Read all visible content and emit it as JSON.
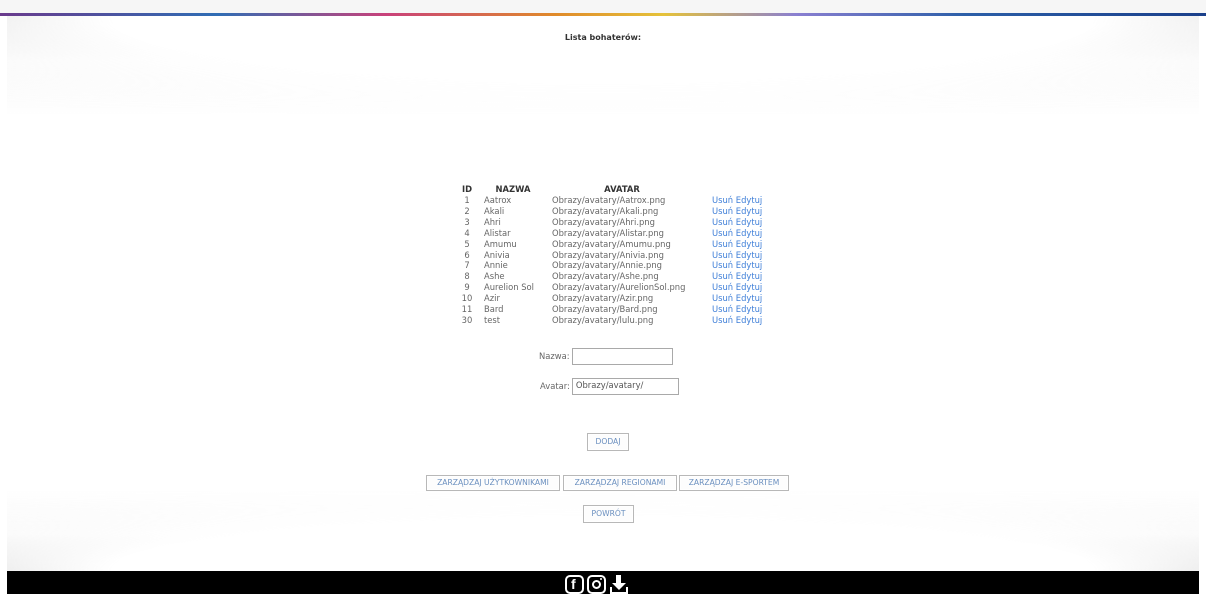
{
  "page": {
    "title": "Lista bohaterów:"
  },
  "table": {
    "headers": {
      "id": "ID",
      "name": "NAZWA",
      "avatar": "AVATAR"
    },
    "rows": [
      {
        "id": "1",
        "name": "Aatrox",
        "avatar": "Obrazy/avatary/Aatrox.png",
        "delete": "Usuń",
        "edit": "Edytuj"
      },
      {
        "id": "2",
        "name": "Akali",
        "avatar": "Obrazy/avatary/Akali.png",
        "delete": "Usuń",
        "edit": "Edytuj"
      },
      {
        "id": "3",
        "name": "Ahri",
        "avatar": "Obrazy/avatary/Ahri.png",
        "delete": "Usuń",
        "edit": "Edytuj"
      },
      {
        "id": "4",
        "name": "Alistar",
        "avatar": "Obrazy/avatary/Alistar.png",
        "delete": "Usuń",
        "edit": "Edytuj"
      },
      {
        "id": "5",
        "name": "Amumu",
        "avatar": "Obrazy/avatary/Amumu.png",
        "delete": "Usuń",
        "edit": "Edytuj"
      },
      {
        "id": "6",
        "name": "Anivia",
        "avatar": "Obrazy/avatary/Anivia.png",
        "delete": "Usuń",
        "edit": "Edytuj"
      },
      {
        "id": "7",
        "name": "Annie",
        "avatar": "Obrazy/avatary/Annie.png",
        "delete": "Usuń",
        "edit": "Edytuj"
      },
      {
        "id": "8",
        "name": "Ashe",
        "avatar": "Obrazy/avatary/Ashe.png",
        "delete": "Usuń",
        "edit": "Edytuj"
      },
      {
        "id": "9",
        "name": "Aurelion Sol",
        "avatar": "Obrazy/avatary/AurelionSol.png",
        "delete": "Usuń",
        "edit": "Edytuj"
      },
      {
        "id": "10",
        "name": "Azir",
        "avatar": "Obrazy/avatary/Azir.png",
        "delete": "Usuń",
        "edit": "Edytuj"
      },
      {
        "id": "11",
        "name": "Bard",
        "avatar": "Obrazy/avatary/Bard.png",
        "delete": "Usuń",
        "edit": "Edytuj"
      },
      {
        "id": "30",
        "name": "test",
        "avatar": "Obrazy/avatary/lulu.png",
        "delete": "Usuń",
        "edit": "Edytuj"
      }
    ]
  },
  "form": {
    "name_label": "Nazwa:",
    "name_value": "",
    "avatar_label": "Avatar:",
    "avatar_value": "Obrazy/avatary/",
    "add_button": "DODAJ"
  },
  "nav": {
    "users": "ZARZĄDZAJ UŻYTKOWNIKAMI",
    "regions": "ZARZĄDZAJ REGIONAMI",
    "esport": "ZARZĄDZAJ E-SPORTEM",
    "back": "POWRÓT"
  },
  "footer": {
    "icons": [
      "facebook-icon",
      "instagram-icon",
      "download-icon"
    ]
  },
  "colors": {
    "link": "#3f7fd8",
    "footer_bg": "#000000"
  }
}
